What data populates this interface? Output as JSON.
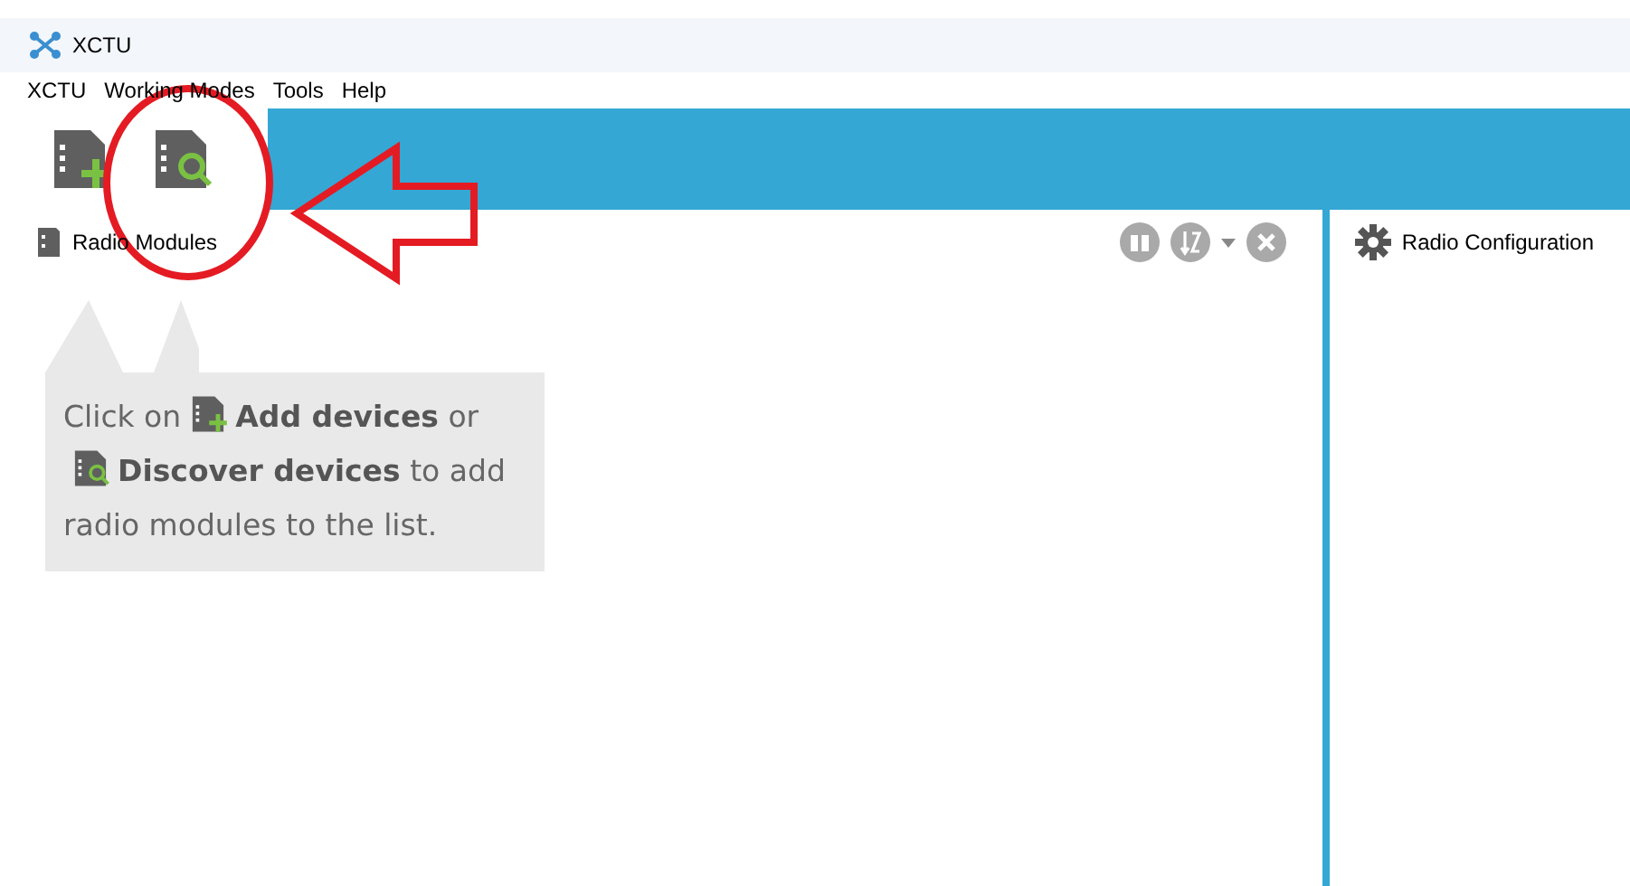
{
  "window": {
    "title": "XCTU"
  },
  "menu": [
    "XCTU",
    "Working Modes",
    "Tools",
    "Help"
  ],
  "left_panel": {
    "title": "Radio Modules"
  },
  "hint": [
    [
      {
        "kind": "text",
        "text": "Click on"
      },
      {
        "kind": "add"
      },
      {
        "kind": "text",
        "text": "**Add devices** or"
      }
    ],
    [
      {
        "kind": "discover"
      },
      {
        "kind": "text",
        "text": "**Discover devices** to add"
      }
    ],
    [
      {
        "kind": "text",
        "text": "radio modules to the list."
      }
    ]
  ],
  "right_panel": {
    "title": "Radio Configuration"
  }
}
